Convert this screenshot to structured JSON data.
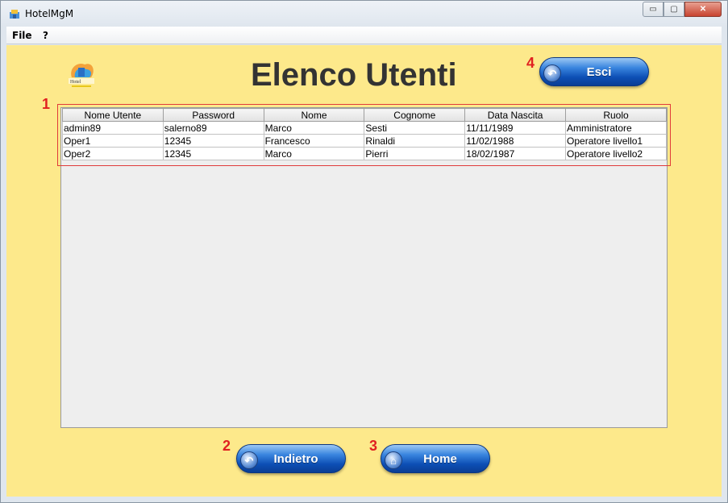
{
  "window": {
    "title": "HotelMgM",
    "controls": {
      "minimize": "▭",
      "maximize": "▢",
      "close": "✕"
    }
  },
  "menubar": {
    "items": [
      "File",
      "?"
    ]
  },
  "header": {
    "logo_icon": "hotel-logo-icon",
    "title": "Elenco Utenti"
  },
  "buttons": {
    "exit": {
      "label": "Esci",
      "icon": "back-arrow-icon",
      "number": "4"
    },
    "back": {
      "label": "Indietro",
      "icon": "back-arrow-icon",
      "number": "2"
    },
    "home": {
      "label": "Home",
      "icon": "home-icon",
      "number": "3"
    }
  },
  "table_marker": "1",
  "table": {
    "columns": [
      "Nome Utente",
      "Password",
      "Nome",
      "Cognome",
      "Data Nascita",
      "Ruolo"
    ],
    "rows": [
      [
        "admin89",
        "salerno89",
        "Marco",
        "Sesti",
        "11/11/1989",
        "Amministratore"
      ],
      [
        "Oper1",
        "12345",
        "Francesco",
        "Rinaldi",
        "11/02/1988",
        "Operatore livello1"
      ],
      [
        "Oper2",
        "12345",
        "Marco",
        "Pierri",
        "18/02/1987",
        "Operatore livello2"
      ]
    ]
  },
  "colors": {
    "background": "#fde98b",
    "accent_marker": "#e02020",
    "button_blue": "#0d4fb5"
  }
}
